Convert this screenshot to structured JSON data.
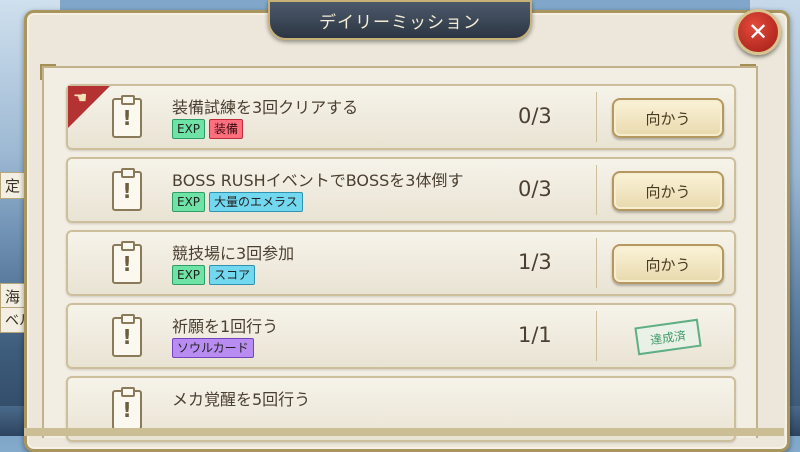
{
  "window": {
    "title": "デイリーミッション",
    "close_symbol": "✕"
  },
  "background": {
    "left_labels": [
      "定",
      "海",
      "ベル"
    ]
  },
  "missions": [
    {
      "title": "装備試練を3回クリアする",
      "tags": [
        {
          "text": "EXP",
          "kind": "exp"
        },
        {
          "text": "装備",
          "kind": "red"
        }
      ],
      "progress": "0/3",
      "action": "向かう",
      "ribbon": true
    },
    {
      "title": "BOSS RUSHイベントでBOSSを3体倒す",
      "tags": [
        {
          "text": "EXP",
          "kind": "exp"
        },
        {
          "text": "大量のエメラス",
          "kind": "blue"
        }
      ],
      "progress": "0/3",
      "action": "向かう"
    },
    {
      "title": "競技場に3回参加",
      "tags": [
        {
          "text": "EXP",
          "kind": "exp"
        },
        {
          "text": "スコア",
          "kind": "blue"
        }
      ],
      "progress": "1/3",
      "action": "向かう"
    },
    {
      "title": "祈願を1回行う",
      "tags": [
        {
          "text": "ソウルカード",
          "kind": "purple"
        }
      ],
      "progress": "1/1",
      "completed_label": "達成済"
    },
    {
      "title": "メカ覚醒を5回行う"
    }
  ],
  "icons": {
    "mission": "clipboard-icon",
    "ribbon": "pointing-hand-icon",
    "close": "close-icon"
  }
}
